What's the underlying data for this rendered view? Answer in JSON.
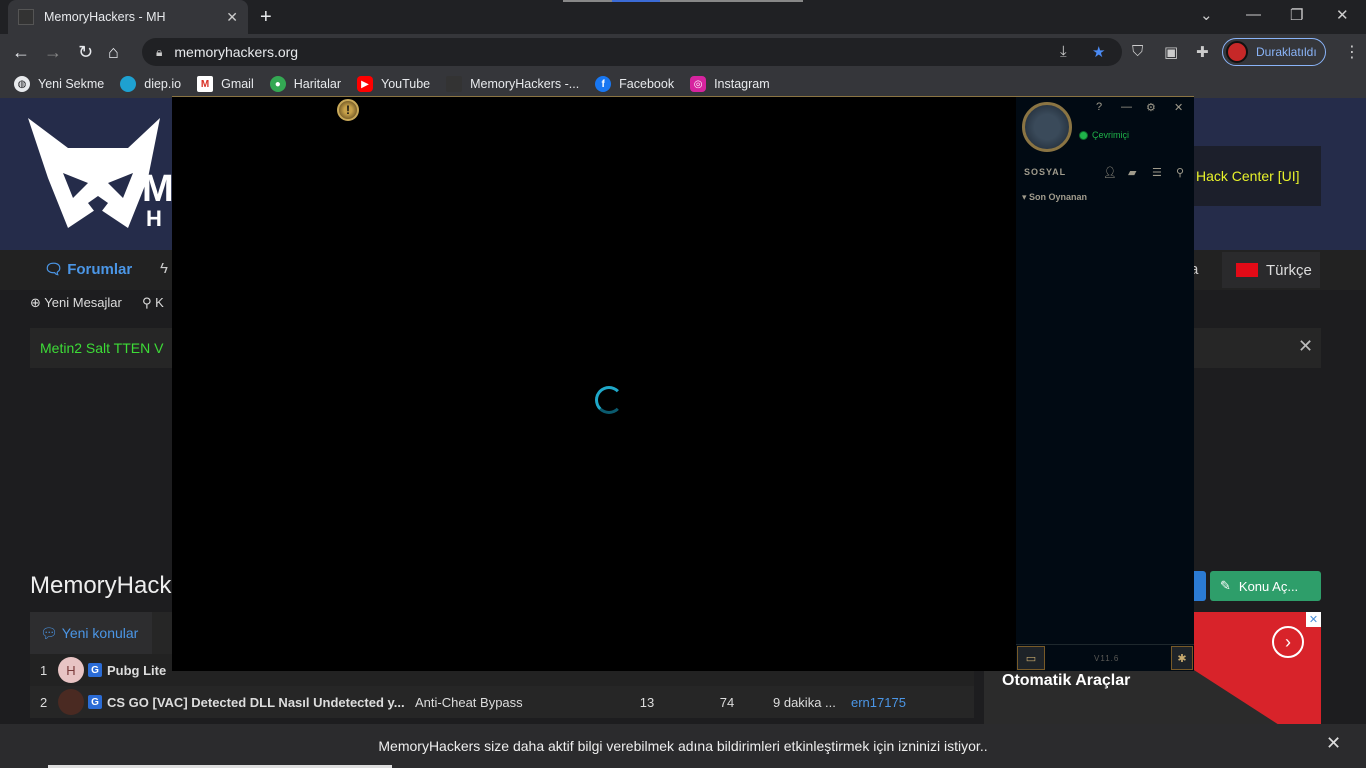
{
  "browser": {
    "tab_title": "MemoryHackers - MH",
    "url": "memoryhackers.org",
    "profile_label": "Duraklatıldı",
    "bookmarks": [
      {
        "label": "Yeni Sekme",
        "icon": "globe-icon"
      },
      {
        "label": "diep.io",
        "icon": "diep-icon"
      },
      {
        "label": "Gmail",
        "icon": "gmail-icon"
      },
      {
        "label": "Haritalar",
        "icon": "maps-icon"
      },
      {
        "label": "YouTube",
        "icon": "youtube-icon"
      },
      {
        "label": "MemoryHackers -...",
        "icon": "memoryhackers-icon"
      },
      {
        "label": "Facebook",
        "icon": "facebook-icon"
      },
      {
        "label": "Instagram",
        "icon": "instagram-icon"
      }
    ]
  },
  "site": {
    "hack_center": "Hack Center [UI]",
    "nav_forums": "Forumlar",
    "nav_partial_a": "a",
    "language": "Türkçe",
    "sub_new_messages": "Yeni Mesajlar",
    "sub_search": "K",
    "notice": "Metin2 Salt TTEN V",
    "page_title": "MemoryHack",
    "new_topic_button": "Konu Aç...",
    "tab_new_topics": "Yeni konular",
    "rows": [
      {
        "num": "1",
        "avatar": "H",
        "title": "Pubg Lite",
        "category": "",
        "n1": "",
        "n2": "",
        "time": "",
        "user": ""
      },
      {
        "num": "2",
        "avatar": "",
        "title": "CS GO [VAC] Detected DLL Nasıl Undetected y...",
        "category": "Anti-Cheat Bypass",
        "n1": "13",
        "n2": "74",
        "time": "9 dakika ...",
        "user": "ern17175"
      }
    ],
    "ad_text": "Otomatik Araçlar",
    "notification": "MemoryHackers size daha aktif bilgi verebilmek adına bildirimleri etkinleştirmek için izninizi istiyor.."
  },
  "client": {
    "status": "Çevrimiçi",
    "social_title": "SOSYAL",
    "recent_group": "Son Oynanan",
    "version": "V11.6"
  }
}
